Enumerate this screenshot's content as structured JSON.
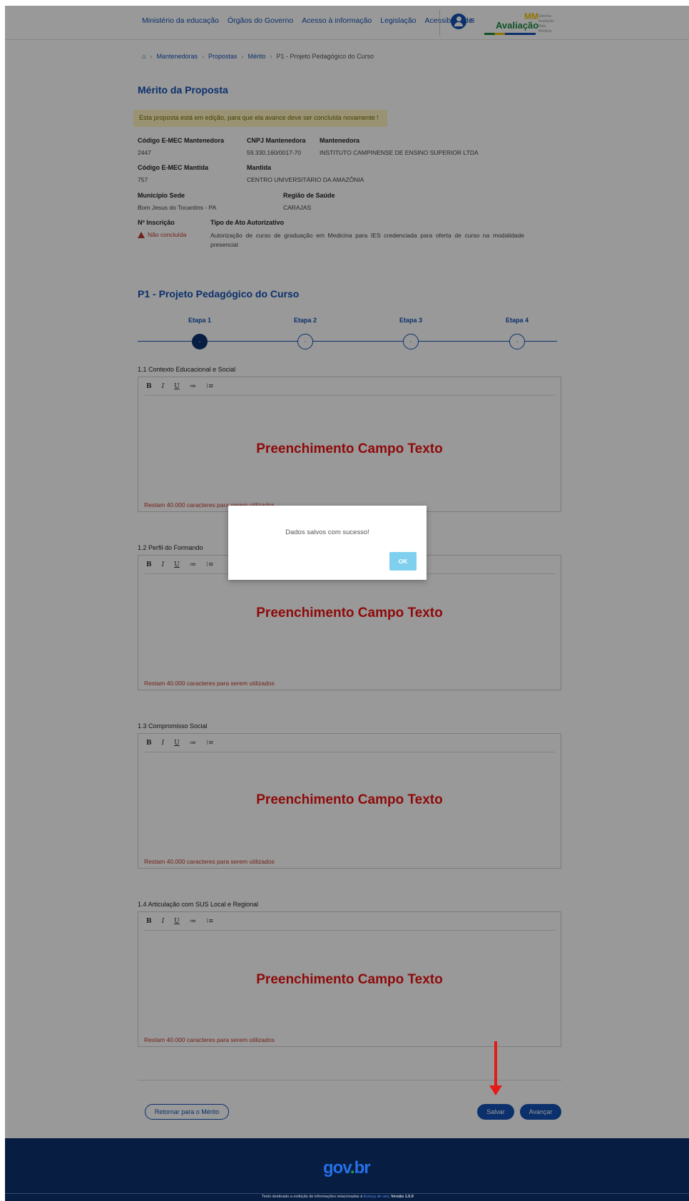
{
  "header": {
    "nav": [
      "Ministério da educação",
      "Órgãos do Governo",
      "Acesso à informação",
      "Legislação",
      "Acessibilidade"
    ],
    "logo": {
      "mm": "MM",
      "text": "Avaliação",
      "tagline": [
        "Sistema",
        "Avaliação",
        "Mais Médicos"
      ]
    }
  },
  "breadcrumb": {
    "home_icon": "home-icon",
    "items": [
      "Mantenedoras",
      "Propostas",
      "Mérito"
    ],
    "current": "P1 - Projeto Pedagógico do Curso"
  },
  "page_title": "Mérito da Proposta",
  "notice": "Esta proposta está em edição, para que ela avance deve ser concluída novamente !",
  "info": {
    "codigo_mantenedora_label": "Código E-MEC Mantenedora",
    "codigo_mantenedora": "2447",
    "cnpj_label": "CNPJ Mantenedora",
    "cnpj": "59.330.160/0017-70",
    "mantenedora_label": "Mantenedora",
    "mantenedora": "INSTITUTO CAMPINENSE DE ENSINO SUPERIOR LTDA",
    "codigo_mantida_label": "Código E-MEC Mantida",
    "codigo_mantida": "757",
    "mantida_label": "Mantida",
    "mantida": "CENTRO UNIVERSITÁRIO DA AMAZÔNIA",
    "municipio_label": "Município Sede",
    "municipio": "Bom Jesus do Tocantins - PA",
    "regiao_label": "Região de Saúde",
    "regiao": "CARAJAS",
    "inscricao_label": "Nº Inscrição",
    "inscricao_status": "Não concluída",
    "ato_label": "Tipo de Ato Autorizativo",
    "ato": "Autorização de curso de graduação em Medicina para IES credenciada para oferta de curso na modalidade presencial"
  },
  "section_title": "P1 - Projeto Pedagógico do Curso",
  "steps": [
    {
      "label": "Etapa 1",
      "active": true
    },
    {
      "label": "Etapa 2",
      "active": false
    },
    {
      "label": "Etapa 3",
      "active": false
    },
    {
      "label": "Etapa 4",
      "active": false
    }
  ],
  "step_dot": "·",
  "toolbar": {
    "bold": "B",
    "italic": "I",
    "underline": "U",
    "bullet_list": "≔",
    "numbered_list": "⁝≡"
  },
  "fields": [
    {
      "label": "1.1 Contexto Educacional e Social",
      "placeholder": "Preenchimento Campo Texto",
      "counter": "Restam 40.000 caracteres para serem utilizados"
    },
    {
      "label": "1.2 Perfil do Formando",
      "placeholder": "Preenchimento Campo Texto",
      "counter": "Restam 40.000 caracteres para serem utilizados"
    },
    {
      "label": "1.3 Compromisso Social",
      "placeholder": "Preenchimento Campo Texto",
      "counter": "Restam 40.000 caracteres para serem utilizados"
    },
    {
      "label": "1.4 Articulação com SUS Local e Regional",
      "placeholder": "Preenchimento Campo Texto",
      "counter": "Restam 40.000 caracteres para serem utilizados"
    }
  ],
  "buttons": {
    "back": "Retornar para o Mérito",
    "save": "Salvar",
    "next": "Avançar"
  },
  "modal": {
    "message": "Dados salvos com sucesso!",
    "ok": "OK"
  },
  "footer": {
    "logo": [
      "gov",
      ".",
      "br"
    ],
    "note_prefix": "Texto destinado a exibição de informações relacionadas à",
    "note_link": "licença de uso",
    "note_version": ". Versão 1.0.0"
  },
  "colors": {
    "primary": "#1351b4",
    "annotation_red": "#e41b17",
    "footer_bg": "#071d41",
    "modal_ok": "#7ed0ee"
  }
}
